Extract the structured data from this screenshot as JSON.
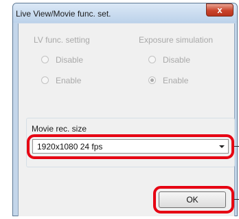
{
  "window": {
    "title": "Live View/Movie func. set.",
    "close_glyph": "x"
  },
  "lv_func": {
    "heading": "LV func. setting",
    "options": [
      {
        "label": "Disable",
        "selected": false
      },
      {
        "label": "Enable",
        "selected": false
      }
    ]
  },
  "exposure_sim": {
    "heading": "Exposure simulation",
    "options": [
      {
        "label": "Disable",
        "selected": false
      },
      {
        "label": "Enable",
        "selected": true
      }
    ]
  },
  "movie_rec": {
    "label": "Movie rec. size",
    "selected_value": "1920x1080  24 fps"
  },
  "ok_button": {
    "label": "OK"
  },
  "colors": {
    "highlight": "#e60012",
    "disabled_text": "#a9a9a9",
    "close_button": "#c9442c"
  },
  "icons": {
    "close": "close-icon",
    "dropdown": "chevron-down-icon"
  }
}
